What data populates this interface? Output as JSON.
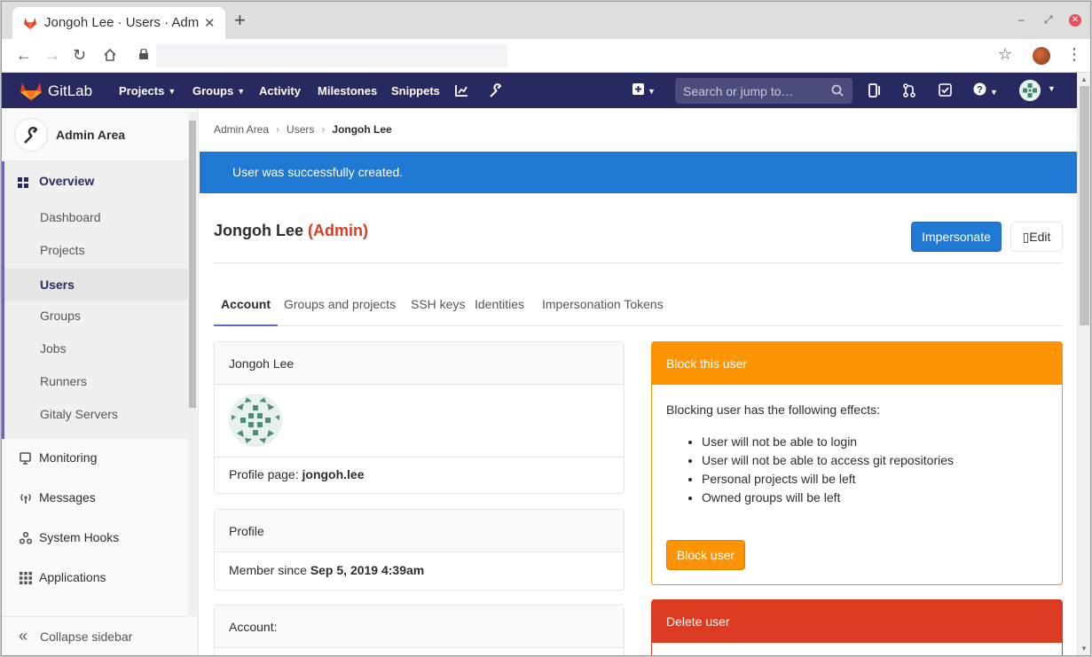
{
  "browser": {
    "tab_title": "Jongoh Lee · Users · Admin Area",
    "tab_close": "✕",
    "new_tab": "+"
  },
  "header": {
    "brand": "GitLab",
    "nav": {
      "projects": "Projects",
      "groups": "Groups",
      "activity": "Activity",
      "milestones": "Milestones",
      "snippets": "Snippets"
    },
    "search_placeholder": "Search or jump to…"
  },
  "sidebar": {
    "context_title": "Admin Area",
    "overview": "Overview",
    "sub_items": [
      "Dashboard",
      "Projects",
      "Users",
      "Groups",
      "Jobs",
      "Runners",
      "Gitaly Servers"
    ],
    "active_sub": "Users",
    "monitoring": "Monitoring",
    "messages": "Messages",
    "system_hooks": "System Hooks",
    "applications": "Applications",
    "collapse": "Collapse sidebar"
  },
  "breadcrumb": [
    "Admin Area",
    "Users",
    "Jongoh Lee"
  ],
  "flash": "User was successfully created.",
  "user": {
    "name": "Jongoh Lee",
    "tag": "(Admin)",
    "profile_label": "Profile page:",
    "profile_handle": "jongoh.lee",
    "member_since_label": "Member since",
    "member_since": "Sep 5, 2019 4:39am"
  },
  "actions": {
    "impersonate": "Impersonate",
    "edit": "Edit"
  },
  "tabs": [
    "Account",
    "Groups and projects",
    "SSH keys",
    "Identities",
    "Impersonation Tokens"
  ],
  "cards": {
    "profile_header": "Profile",
    "account_header": "Account:"
  },
  "block": {
    "title": "Block this user",
    "intro": "Blocking user has the following effects:",
    "effects": [
      "User will not be able to login",
      "User will not be able to access git repositories",
      "Personal projects will be left",
      "Owned groups will be left"
    ],
    "button": "Block user"
  },
  "delete": {
    "title": "Delete user"
  },
  "colors": {
    "header_bg": "#292961",
    "accent_blue": "#1f78d1",
    "warning": "#fc9403",
    "danger": "#db3b21"
  }
}
